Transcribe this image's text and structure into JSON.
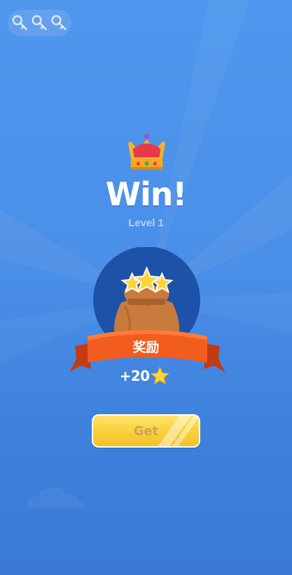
{
  "hud": {
    "keys_total": 3,
    "key_icon": "key-icon"
  },
  "result": {
    "icon": "crown-icon",
    "title": "Win!",
    "level": "Level 1"
  },
  "reward": {
    "icon": "coin-bag-icon",
    "label": "奖励",
    "amount": "+20",
    "currency_icon": "star-icon"
  },
  "actions": {
    "get_label": "Get"
  },
  "colors": {
    "background": "#4a8fe8",
    "circle": "#1e52a8",
    "ribbon": "#f25c1f",
    "button": "#f9cf3a",
    "star": "#ffd43b"
  }
}
